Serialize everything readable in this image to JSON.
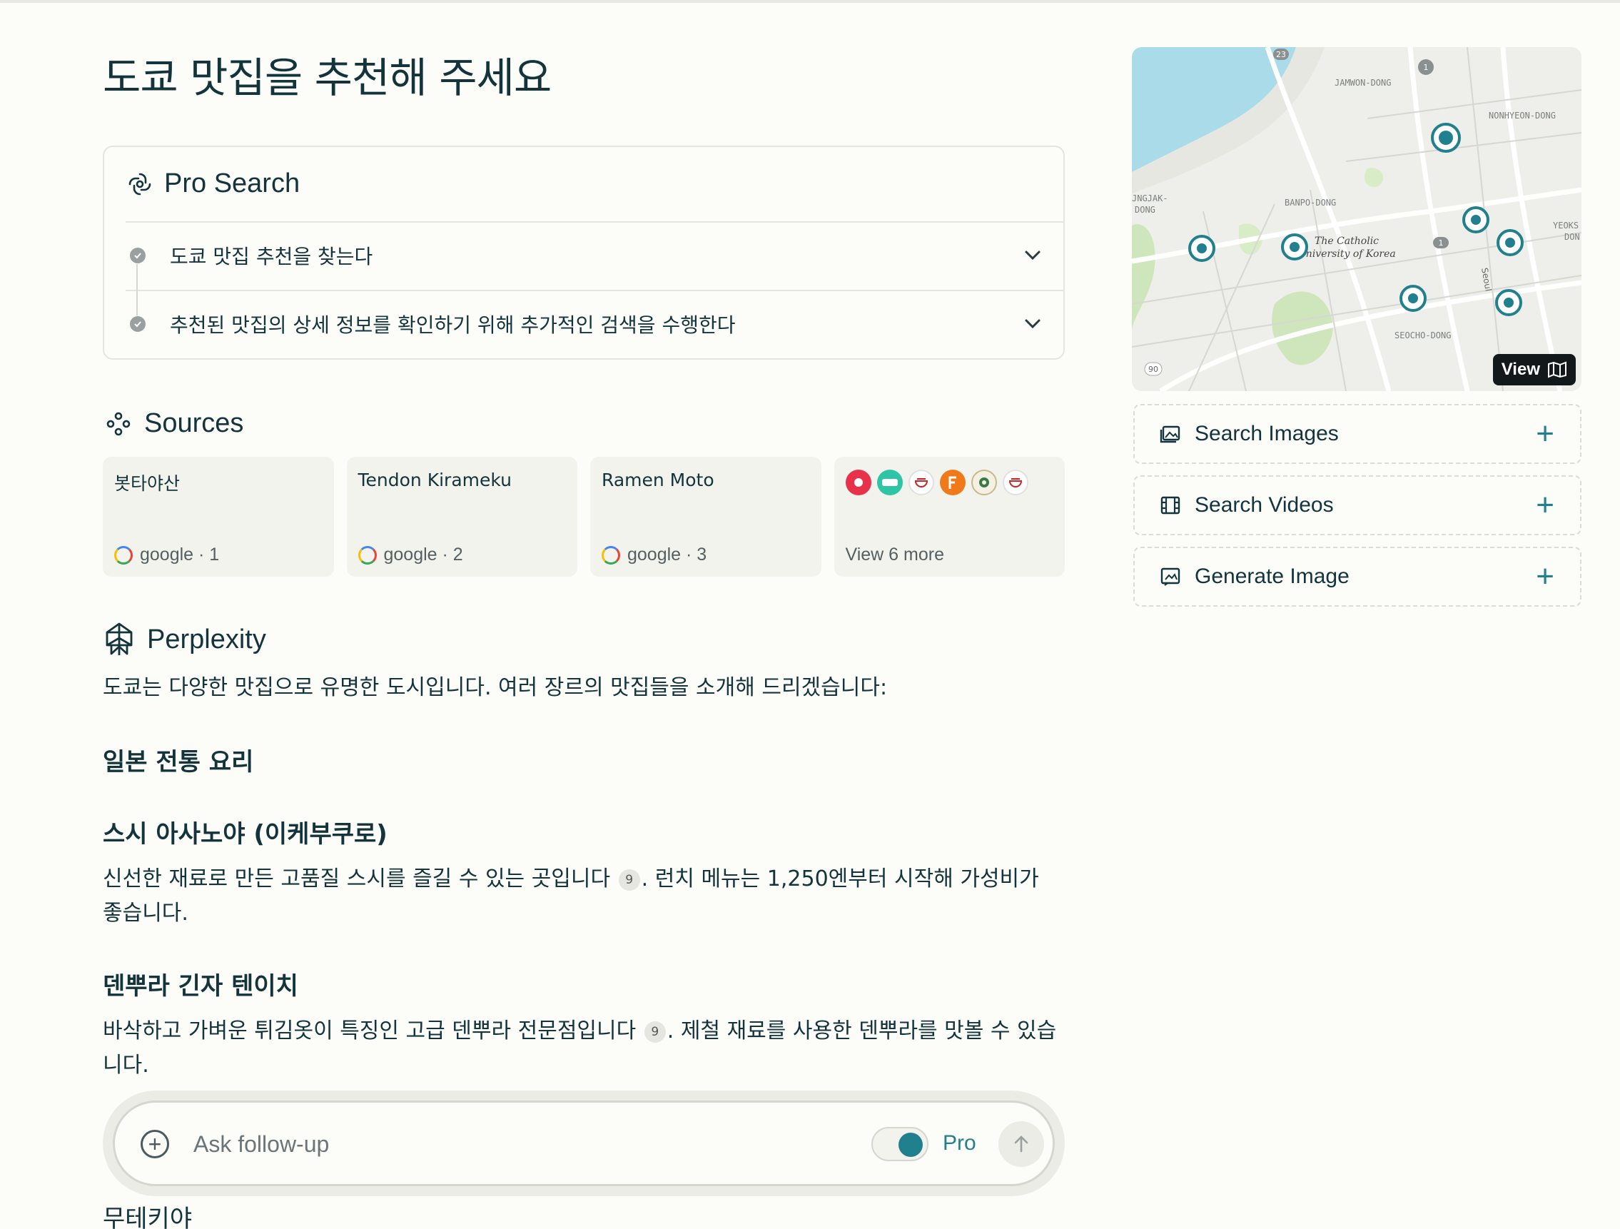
{
  "page": {
    "title": "도쿄 맛집을 추천해 주세요"
  },
  "pro_search": {
    "label": "Pro Search",
    "steps": [
      {
        "text": "도쿄 맛집 추천을 찾는다"
      },
      {
        "text": "추천된 맛집의 상세 정보를 확인하기 위해 추가적인 검색을 수행한다"
      }
    ]
  },
  "sources": {
    "label": "Sources",
    "cards": [
      {
        "title": "봇타야산",
        "meta": "google · 1"
      },
      {
        "title": "Tendon Kirameku",
        "meta": "google · 2"
      },
      {
        "title": "Ramen Moto",
        "meta": "google · 3"
      }
    ],
    "more_label": "View 6 more"
  },
  "answer": {
    "label": "Perplexity",
    "intro": "도쿄는 다양한 맛집으로 유명한 도시입니다. 여러 장르의 맛집들을 소개해 드리겠습니다:",
    "section_title": "일본 전통 요리",
    "items": [
      {
        "title": "스시 아사노야 (이케부쿠로)",
        "text_before": "신선한 재료로 만든 고품질 스시를 즐길 수 있는 곳입니다",
        "citation": "9",
        "text_after": ". 런치 메뉴는 1,250엔부터 시작해 가성비가 좋습니다."
      },
      {
        "title": "덴뿌라 긴자 텐이치",
        "text_before": "바삭하고 가벼운 튀김옷이 특징인 고급 덴뿌라 전문점입니다",
        "citation": "9",
        "text_after": ". 제철 재료를 사용한 덴뿌라를 맛볼 수 있습니다."
      }
    ],
    "next_title": "무테키야"
  },
  "followup": {
    "placeholder": "Ask follow-up",
    "pro_label": "Pro",
    "pro_enabled": true
  },
  "map": {
    "view_label": "View",
    "labels": [
      "JAMWON-DONG",
      "NONHYEON-DONG",
      "BANPO-DONG",
      "The Catholic",
      "University of Korea",
      "SEOCHO-DONG",
      "JNGJAK-",
      "DONG",
      "YEOKS",
      "DON",
      "Seoul"
    ],
    "badges": [
      "23",
      "1",
      "1",
      "90"
    ]
  },
  "actions": [
    {
      "label": "Search Images",
      "icon": "image-icon"
    },
    {
      "label": "Search Videos",
      "icon": "film-icon"
    },
    {
      "label": "Generate Image",
      "icon": "generate-image-icon"
    }
  ],
  "colors": {
    "accent": "#20808d",
    "text": "#13343b",
    "background": "#fcfcf9"
  }
}
